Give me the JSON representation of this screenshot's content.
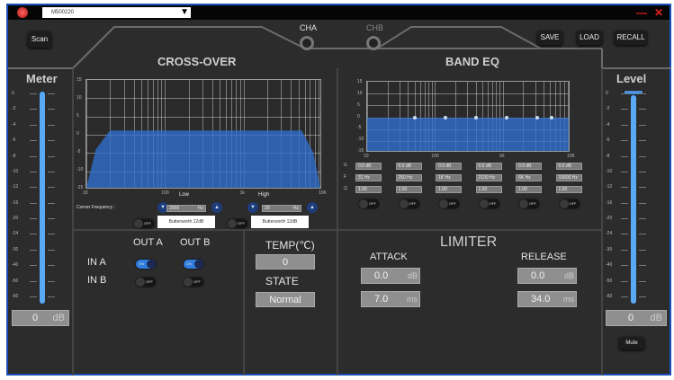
{
  "titlebar": {
    "device": "M500220",
    "minimize": "—",
    "close": "✕"
  },
  "toolbar": {
    "scan": "Scan",
    "save": "SAVE",
    "load": "LOAD",
    "recall": "RECALL"
  },
  "channels": {
    "cha": "CHA",
    "chb": "CHB"
  },
  "crossover": {
    "title": "CROSS-OVER",
    "y_ticks": [
      "15",
      "10",
      "5",
      "0",
      "-5",
      "-10",
      "-15"
    ],
    "x_ticks": [
      "10",
      "100",
      "1k",
      "10K"
    ],
    "low_label": "Low",
    "high_label": "High",
    "corner_frequency_label": "Corner Frequency :",
    "low_freq": "2000",
    "high_freq": "20",
    "unit": "Hz",
    "low_filter": "Butterworth 12dB",
    "high_filter": "Butterworth 12dB",
    "low_toggle": "OFF",
    "high_toggle": "OFF"
  },
  "band_eq": {
    "title": "BAND EQ",
    "y_ticks": [
      "15",
      "10",
      "5",
      "0",
      "-5",
      "-10",
      "-15"
    ],
    "x_ticks": [
      "10",
      "100",
      "1K",
      "10K"
    ],
    "row_labels": [
      "G",
      "F",
      "Q"
    ],
    "bands": [
      {
        "g": "0.0 dB",
        "f": "31 Hz",
        "q": "1.00",
        "toggle": "OFF"
      },
      {
        "g": "0.0 dB",
        "f": "250 Hz",
        "q": "1.00",
        "toggle": "OFF"
      },
      {
        "g": "0.0 dB",
        "f": "1K Hz",
        "q": "1.00",
        "toggle": "OFF"
      },
      {
        "g": "0.0 dB",
        "f": "2100 Hz",
        "q": "1.00",
        "toggle": "OFF"
      },
      {
        "g": "0.0 dB",
        "f": "6K Hz",
        "q": "1.00",
        "toggle": "OFF"
      },
      {
        "g": "0.0 dB",
        "f": "15600 Hz",
        "q": "1.00",
        "toggle": "OFF"
      }
    ]
  },
  "meter": {
    "title": "Meter",
    "scale": [
      "0",
      "-2",
      "-4",
      "-6",
      "-8",
      "-10",
      "-12",
      "-16",
      "-20",
      "-24",
      "-30",
      "-40",
      "-50",
      "-60"
    ],
    "value": "0",
    "unit": "dB",
    "level": 1.0
  },
  "level": {
    "title": "Level",
    "scale": [
      "0",
      "-2",
      "-4",
      "-6",
      "-8",
      "-10",
      "-12",
      "-16",
      "-20",
      "-24",
      "-30",
      "-40",
      "-50",
      "-60"
    ],
    "value": "0",
    "unit": "dB",
    "mute": "Mute",
    "level": 1.0
  },
  "matrix": {
    "out_a": "OUT A",
    "out_b": "OUT B",
    "in_a": "IN A",
    "in_b": "IN B",
    "in_a_out_a": "ON",
    "in_a_out_b": "ON",
    "in_b_out_a": "OFF",
    "in_b_out_b": "OFF"
  },
  "status": {
    "temp_label": "TEMP(℃)",
    "temp": "0",
    "state_label": "STATE",
    "state": "Normal"
  },
  "limiter": {
    "title": "LIMITER",
    "attack_label": "ATTACK",
    "release_label": "RELEASE",
    "attack_threshold": "0.0",
    "attack_threshold_unit": "dB",
    "attack_time": "7.0",
    "attack_time_unit": "ms",
    "release_threshold": "0.0",
    "release_threshold_unit": "dB",
    "release_time": "34.0",
    "release_time_unit": "ms"
  },
  "colors": {
    "accent": "#2f7ee0",
    "fill": "#2f6fcf",
    "close": "#e0201a"
  }
}
